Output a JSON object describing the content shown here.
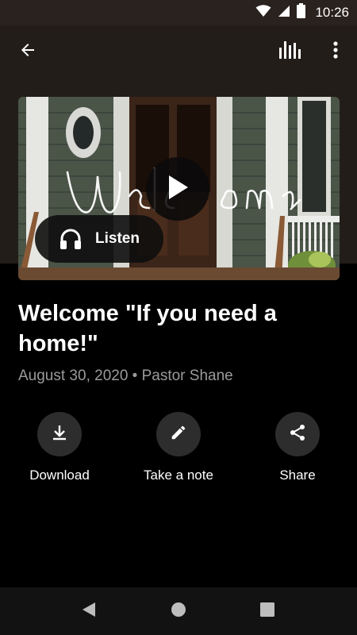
{
  "status_bar": {
    "time": "10:26",
    "icons": [
      "wifi-icon",
      "signal-icon",
      "battery-icon"
    ]
  },
  "app_bar": {
    "icons": [
      "back-arrow-icon",
      "audio-bars-icon",
      "more-vert-icon"
    ]
  },
  "artwork": {
    "icons": [
      "play-icon"
    ]
  },
  "listen_button": {
    "label": "Listen",
    "icon": "headphones-icon"
  },
  "sermon": {
    "title": "Welcome \"If you need a home!\"",
    "meta": "August 30, 2020 • Pastor Shane"
  },
  "actions": [
    {
      "label": "Download",
      "icon": "download-icon"
    },
    {
      "label": "Take a note",
      "icon": "pencil-icon"
    },
    {
      "label": "Share",
      "icon": "share-icon"
    }
  ],
  "nav_bar": {
    "icons": [
      "nav-back-icon",
      "nav-home-icon",
      "nav-recents-icon"
    ]
  },
  "colors": {
    "header_background": "#231d1a",
    "page_background": "#000000",
    "meta_text": "#9a9a9a",
    "action_circle": "#2d2d2d"
  }
}
